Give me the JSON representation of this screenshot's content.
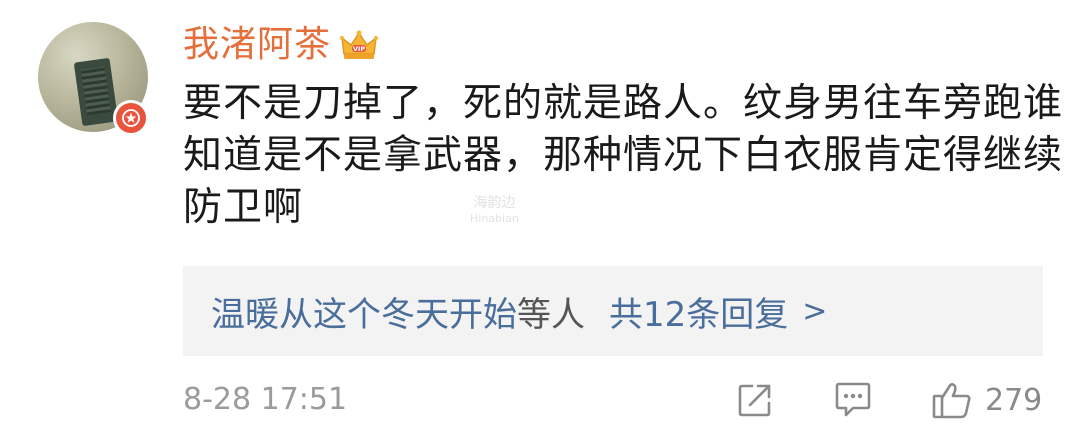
{
  "user": {
    "name": "我渚阿茶",
    "avatar_icon": "avatar-photo",
    "badge_icon": "star-badge-icon",
    "badge_color": "#e8543d",
    "vip_icon": "crown-icon",
    "name_color": "#e56f3a"
  },
  "comment": {
    "text": "要不是刀掉了，死的就是路人。纹身男往车旁跑谁知道是不是拿武器，那种情况下白衣服肯定得继续防卫啊"
  },
  "watermark": {
    "cn": "海韵边",
    "en": "Hinabian"
  },
  "replies": {
    "participants": "温暖从这个冬天开始",
    "and_text": "等人",
    "count_text": "共12条回复",
    "chevron": ">",
    "link_color": "#4a6e9c"
  },
  "footer": {
    "timestamp": "8-28 17:51",
    "like_count": "279",
    "share_icon": "share-icon",
    "comment_icon": "comment-icon",
    "like_icon": "thumbs-up-icon"
  }
}
